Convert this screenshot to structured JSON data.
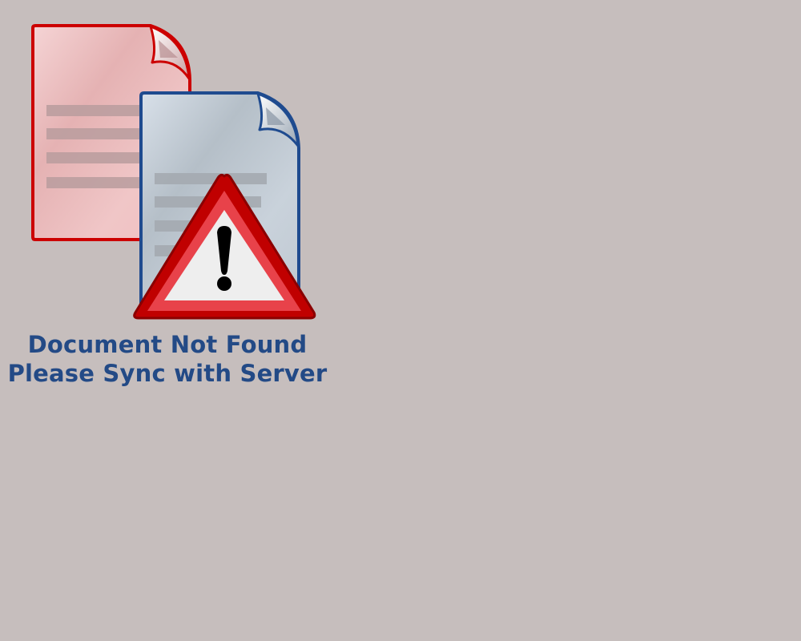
{
  "message": {
    "line1": "Document Not Found",
    "line2": "Please Sync with Server"
  },
  "icons": {
    "back_document": "document-icon",
    "front_document": "document-icon",
    "warning": "warning-icon"
  },
  "colors": {
    "background": "#c6bebd",
    "text": "#234a86",
    "back_document_border": "#cc0000",
    "back_document_fill": "#f0c6c7",
    "front_document_border": "#1f4b8f",
    "front_document_fill": "#c4ccd3",
    "warning_red": "#c00000",
    "warning_fill": "#eeeeee",
    "exclamation": "#000000"
  }
}
